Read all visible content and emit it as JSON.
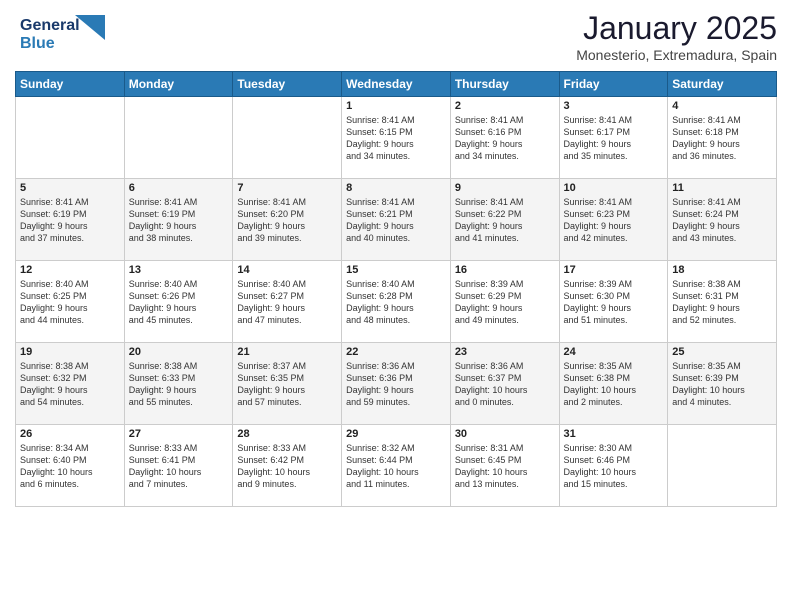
{
  "logo": {
    "line1": "General",
    "line2": "Blue"
  },
  "title": "January 2025",
  "subtitle": "Monesterio, Extremadura, Spain",
  "days_of_week": [
    "Sunday",
    "Monday",
    "Tuesday",
    "Wednesday",
    "Thursday",
    "Friday",
    "Saturday"
  ],
  "weeks": [
    [
      {
        "day": "",
        "info": ""
      },
      {
        "day": "",
        "info": ""
      },
      {
        "day": "",
        "info": ""
      },
      {
        "day": "1",
        "info": "Sunrise: 8:41 AM\nSunset: 6:15 PM\nDaylight: 9 hours\nand 34 minutes."
      },
      {
        "day": "2",
        "info": "Sunrise: 8:41 AM\nSunset: 6:16 PM\nDaylight: 9 hours\nand 34 minutes."
      },
      {
        "day": "3",
        "info": "Sunrise: 8:41 AM\nSunset: 6:17 PM\nDaylight: 9 hours\nand 35 minutes."
      },
      {
        "day": "4",
        "info": "Sunrise: 8:41 AM\nSunset: 6:18 PM\nDaylight: 9 hours\nand 36 minutes."
      }
    ],
    [
      {
        "day": "5",
        "info": "Sunrise: 8:41 AM\nSunset: 6:19 PM\nDaylight: 9 hours\nand 37 minutes."
      },
      {
        "day": "6",
        "info": "Sunrise: 8:41 AM\nSunset: 6:19 PM\nDaylight: 9 hours\nand 38 minutes."
      },
      {
        "day": "7",
        "info": "Sunrise: 8:41 AM\nSunset: 6:20 PM\nDaylight: 9 hours\nand 39 minutes."
      },
      {
        "day": "8",
        "info": "Sunrise: 8:41 AM\nSunset: 6:21 PM\nDaylight: 9 hours\nand 40 minutes."
      },
      {
        "day": "9",
        "info": "Sunrise: 8:41 AM\nSunset: 6:22 PM\nDaylight: 9 hours\nand 41 minutes."
      },
      {
        "day": "10",
        "info": "Sunrise: 8:41 AM\nSunset: 6:23 PM\nDaylight: 9 hours\nand 42 minutes."
      },
      {
        "day": "11",
        "info": "Sunrise: 8:41 AM\nSunset: 6:24 PM\nDaylight: 9 hours\nand 43 minutes."
      }
    ],
    [
      {
        "day": "12",
        "info": "Sunrise: 8:40 AM\nSunset: 6:25 PM\nDaylight: 9 hours\nand 44 minutes."
      },
      {
        "day": "13",
        "info": "Sunrise: 8:40 AM\nSunset: 6:26 PM\nDaylight: 9 hours\nand 45 minutes."
      },
      {
        "day": "14",
        "info": "Sunrise: 8:40 AM\nSunset: 6:27 PM\nDaylight: 9 hours\nand 47 minutes."
      },
      {
        "day": "15",
        "info": "Sunrise: 8:40 AM\nSunset: 6:28 PM\nDaylight: 9 hours\nand 48 minutes."
      },
      {
        "day": "16",
        "info": "Sunrise: 8:39 AM\nSunset: 6:29 PM\nDaylight: 9 hours\nand 49 minutes."
      },
      {
        "day": "17",
        "info": "Sunrise: 8:39 AM\nSunset: 6:30 PM\nDaylight: 9 hours\nand 51 minutes."
      },
      {
        "day": "18",
        "info": "Sunrise: 8:38 AM\nSunset: 6:31 PM\nDaylight: 9 hours\nand 52 minutes."
      }
    ],
    [
      {
        "day": "19",
        "info": "Sunrise: 8:38 AM\nSunset: 6:32 PM\nDaylight: 9 hours\nand 54 minutes."
      },
      {
        "day": "20",
        "info": "Sunrise: 8:38 AM\nSunset: 6:33 PM\nDaylight: 9 hours\nand 55 minutes."
      },
      {
        "day": "21",
        "info": "Sunrise: 8:37 AM\nSunset: 6:35 PM\nDaylight: 9 hours\nand 57 minutes."
      },
      {
        "day": "22",
        "info": "Sunrise: 8:36 AM\nSunset: 6:36 PM\nDaylight: 9 hours\nand 59 minutes."
      },
      {
        "day": "23",
        "info": "Sunrise: 8:36 AM\nSunset: 6:37 PM\nDaylight: 10 hours\nand 0 minutes."
      },
      {
        "day": "24",
        "info": "Sunrise: 8:35 AM\nSunset: 6:38 PM\nDaylight: 10 hours\nand 2 minutes."
      },
      {
        "day": "25",
        "info": "Sunrise: 8:35 AM\nSunset: 6:39 PM\nDaylight: 10 hours\nand 4 minutes."
      }
    ],
    [
      {
        "day": "26",
        "info": "Sunrise: 8:34 AM\nSunset: 6:40 PM\nDaylight: 10 hours\nand 6 minutes."
      },
      {
        "day": "27",
        "info": "Sunrise: 8:33 AM\nSunset: 6:41 PM\nDaylight: 10 hours\nand 7 minutes."
      },
      {
        "day": "28",
        "info": "Sunrise: 8:33 AM\nSunset: 6:42 PM\nDaylight: 10 hours\nand 9 minutes."
      },
      {
        "day": "29",
        "info": "Sunrise: 8:32 AM\nSunset: 6:44 PM\nDaylight: 10 hours\nand 11 minutes."
      },
      {
        "day": "30",
        "info": "Sunrise: 8:31 AM\nSunset: 6:45 PM\nDaylight: 10 hours\nand 13 minutes."
      },
      {
        "day": "31",
        "info": "Sunrise: 8:30 AM\nSunset: 6:46 PM\nDaylight: 10 hours\nand 15 minutes."
      },
      {
        "day": "",
        "info": ""
      }
    ]
  ]
}
